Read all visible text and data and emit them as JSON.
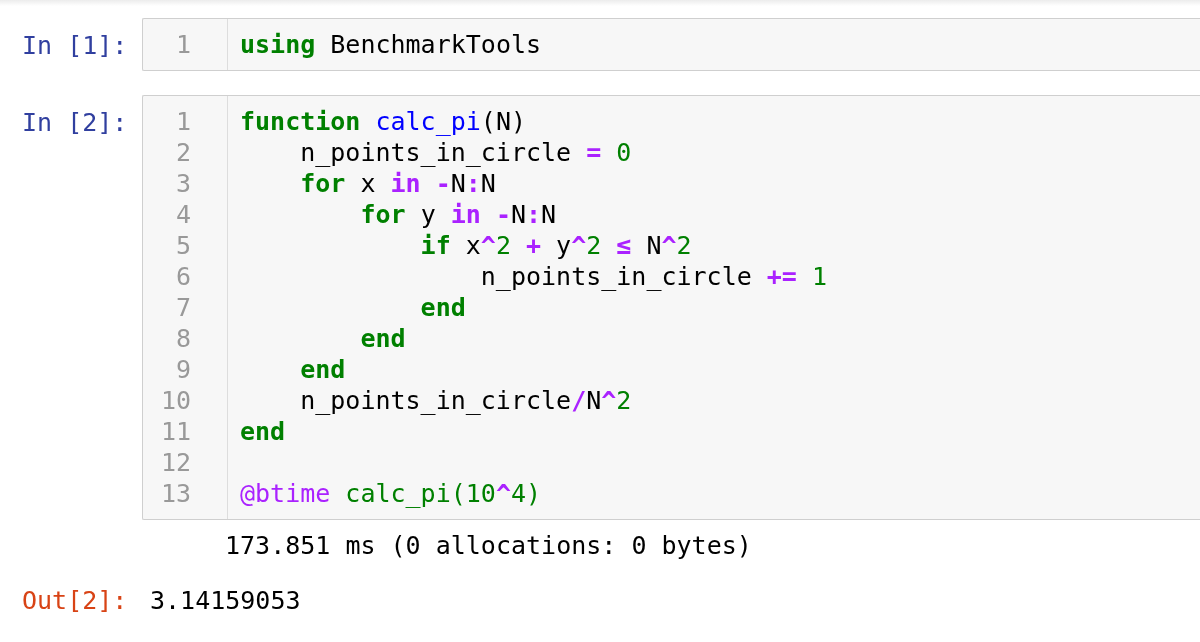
{
  "cells": [
    {
      "prompt": "In [1]:",
      "lines": [
        {
          "number": "1",
          "tokens": [
            {
              "kind": "keyword",
              "text": "using"
            },
            {
              "kind": "plain",
              "text": " BenchmarkTools"
            }
          ]
        }
      ]
    },
    {
      "prompt": "In [2]:",
      "lines": [
        {
          "number": "1",
          "tokens": [
            {
              "kind": "keyword",
              "text": "function "
            },
            {
              "kind": "function",
              "text": "calc_pi"
            },
            {
              "kind": "plain",
              "text": "(N)"
            }
          ]
        },
        {
          "number": "2",
          "tokens": [
            {
              "kind": "plain",
              "text": "    n_points_in_circle "
            },
            {
              "kind": "operator",
              "text": "= "
            },
            {
              "kind": "number",
              "text": "0"
            }
          ]
        },
        {
          "number": "3",
          "tokens": [
            {
              "kind": "keyword",
              "text": "    for"
            },
            {
              "kind": "plain",
              "text": " x "
            },
            {
              "kind": "operator",
              "text": "in -"
            },
            {
              "kind": "plain",
              "text": "N"
            },
            {
              "kind": "operator",
              "text": ":"
            },
            {
              "kind": "plain",
              "text": "N"
            }
          ]
        },
        {
          "number": "4",
          "tokens": [
            {
              "kind": "keyword",
              "text": "        for"
            },
            {
              "kind": "plain",
              "text": " y "
            },
            {
              "kind": "operator",
              "text": "in -"
            },
            {
              "kind": "plain",
              "text": "N"
            },
            {
              "kind": "operator",
              "text": ":"
            },
            {
              "kind": "plain",
              "text": "N"
            }
          ]
        },
        {
          "number": "5",
          "tokens": [
            {
              "kind": "keyword",
              "text": "            if"
            },
            {
              "kind": "plain",
              "text": " x"
            },
            {
              "kind": "operator",
              "text": "^"
            },
            {
              "kind": "number",
              "text": "2"
            },
            {
              "kind": "operator",
              "text": " + "
            },
            {
              "kind": "plain",
              "text": "y"
            },
            {
              "kind": "operator",
              "text": "^"
            },
            {
              "kind": "number",
              "text": "2"
            },
            {
              "kind": "operator",
              "text": " ≤ "
            },
            {
              "kind": "plain",
              "text": "N"
            },
            {
              "kind": "operator",
              "text": "^"
            },
            {
              "kind": "number",
              "text": "2"
            }
          ]
        },
        {
          "number": "6",
          "tokens": [
            {
              "kind": "plain",
              "text": "                n_points_in_circle "
            },
            {
              "kind": "operator",
              "text": "+= "
            },
            {
              "kind": "number",
              "text": "1"
            }
          ]
        },
        {
          "number": "7",
          "tokens": [
            {
              "kind": "keyword",
              "text": "            end"
            }
          ]
        },
        {
          "number": "8",
          "tokens": [
            {
              "kind": "keyword",
              "text": "        end"
            }
          ]
        },
        {
          "number": "9",
          "tokens": [
            {
              "kind": "keyword",
              "text": "    end"
            }
          ]
        },
        {
          "number": "10",
          "tokens": [
            {
              "kind": "plain",
              "text": "    n_points_in_circle"
            },
            {
              "kind": "operator",
              "text": "/"
            },
            {
              "kind": "plain",
              "text": "N"
            },
            {
              "kind": "operator",
              "text": "^"
            },
            {
              "kind": "number",
              "text": "2"
            }
          ]
        },
        {
          "number": "11",
          "tokens": [
            {
              "kind": "keyword",
              "text": "end"
            }
          ]
        },
        {
          "number": "12"
        },
        {
          "number": "13",
          "tokens": [
            {
              "kind": "macro",
              "text": "@btime "
            },
            {
              "kind": "number",
              "text": "calc_pi(10"
            },
            {
              "kind": "operator",
              "text": "^"
            },
            {
              "kind": "number",
              "text": "4)"
            }
          ]
        }
      ],
      "stdout": "173.851 ms (0 allocations: 0 bytes)",
      "output": {
        "prompt": "Out[2]:",
        "value": "3.14159053"
      }
    }
  ]
}
